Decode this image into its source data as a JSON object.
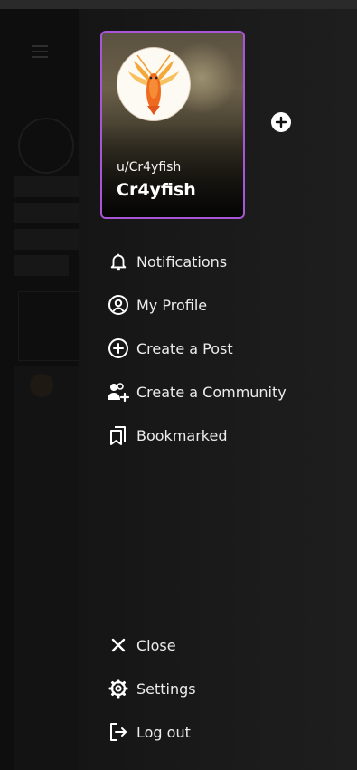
{
  "account": {
    "handle": "u/Cr4yfish",
    "display_name": "Cr4yfish"
  },
  "menu": [
    {
      "id": "notifications",
      "label": "Notifications",
      "icon": "bell-icon"
    },
    {
      "id": "my-profile",
      "label": "My Profile",
      "icon": "user-circle-icon"
    },
    {
      "id": "create-post",
      "label": "Create a Post",
      "icon": "plus-circle-icon"
    },
    {
      "id": "create-community",
      "label": "Create a Community",
      "icon": "users-plus-icon"
    },
    {
      "id": "bookmarked",
      "label": "Bookmarked",
      "icon": "bookmarks-icon"
    }
  ],
  "footer_menu": [
    {
      "id": "close",
      "label": "Close",
      "icon": "close-icon"
    },
    {
      "id": "settings",
      "label": "Settings",
      "icon": "gear-icon"
    },
    {
      "id": "logout",
      "label": "Log out",
      "icon": "logout-icon"
    }
  ],
  "colors": {
    "accent": "#a855d8",
    "drawer": "#181818",
    "text": "#ececec"
  }
}
